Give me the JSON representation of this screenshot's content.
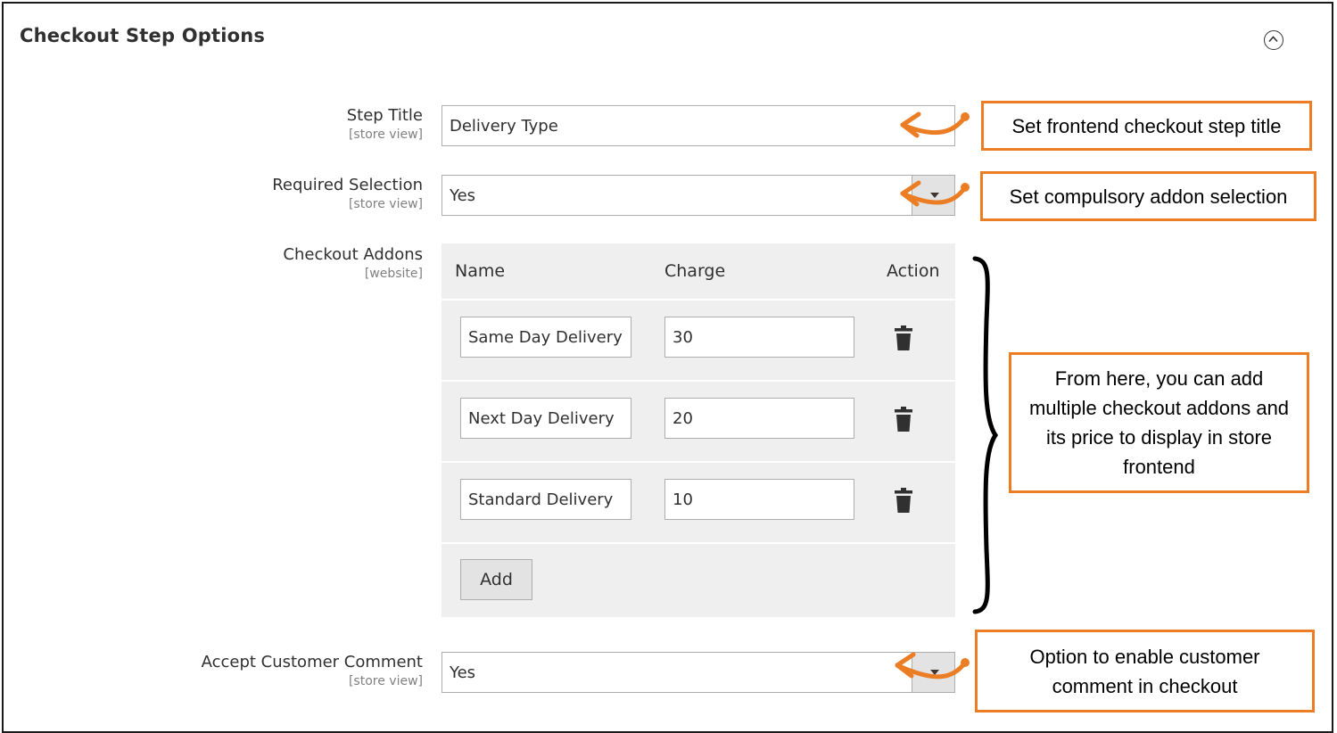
{
  "section": {
    "title": "Checkout Step Options"
  },
  "fields": {
    "step_title": {
      "label": "Step Title",
      "scope": "[store view]",
      "value": "Delivery Type"
    },
    "required_selection": {
      "label": "Required Selection",
      "scope": "[store view]",
      "value": "Yes"
    },
    "checkout_addons": {
      "label": "Checkout Addons",
      "scope": "[website]"
    },
    "accept_comment": {
      "label": "Accept Customer Comment",
      "scope": "[store view]",
      "value": "Yes"
    }
  },
  "addons_table": {
    "headers": {
      "name": "Name",
      "charge": "Charge",
      "action": "Action"
    },
    "rows": [
      {
        "name": "Same Day Delivery",
        "charge": "30"
      },
      {
        "name": "Next Day Delivery",
        "charge": "20"
      },
      {
        "name": "Standard Delivery",
        "charge": "10"
      }
    ],
    "add_label": "Add"
  },
  "callouts": {
    "step_title": "Set frontend checkout step title",
    "required_selection": "Set compulsory addon selection",
    "addons": "From here, you can add multiple checkout addons and its price to display in store frontend",
    "comment": "Option to enable customer comment in checkout"
  },
  "colors": {
    "accent": "#eb7d25",
    "table_bg": "#efefef",
    "button_bg": "#e3e3e3"
  },
  "icons": [
    "chevron-up-circle-icon",
    "trash-icon",
    "curved-arrow-icon",
    "brace-icon"
  ]
}
